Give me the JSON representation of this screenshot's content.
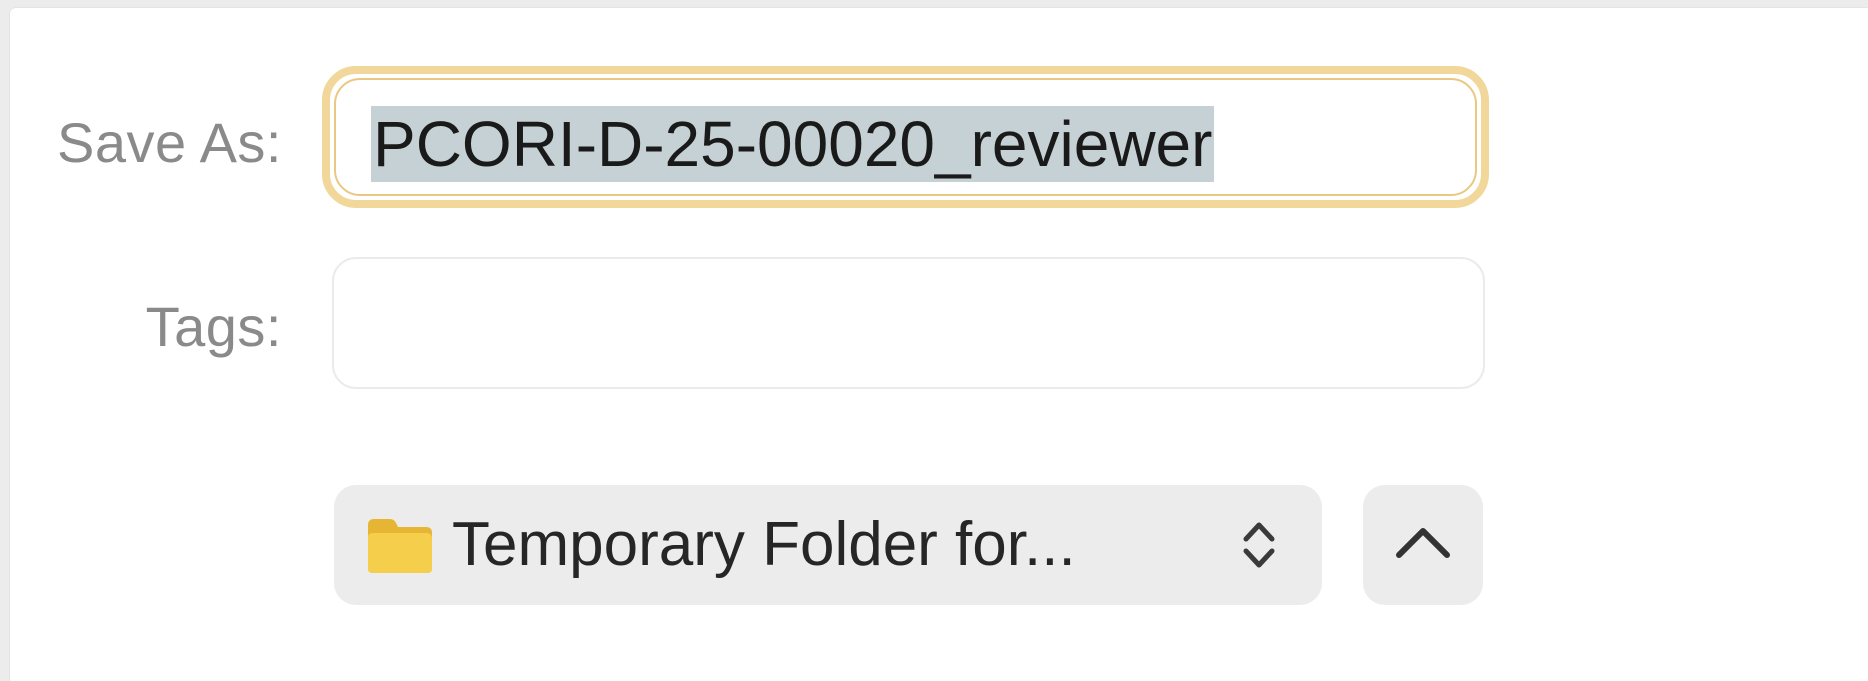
{
  "dialog": {
    "save_as_label": "Save As:",
    "save_as_value": "PCORI-D-25-00020_reviewer",
    "tags_label": "Tags:",
    "tags_value": "",
    "location": {
      "icon": "folder-icon",
      "label": "Temporary Folder for...",
      "chevron": "up-down-chevron-icon"
    },
    "expand_button": {
      "icon": "chevron-up-icon"
    },
    "colors": {
      "focus_ring": "#f1d89a",
      "selection": "#c5d1d4",
      "folder": "#f2c94c",
      "popup_bg": "#ececec"
    }
  }
}
